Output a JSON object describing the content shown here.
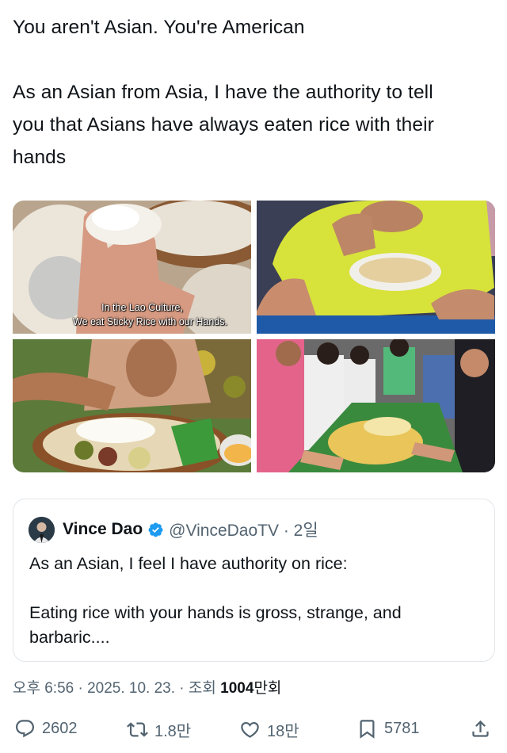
{
  "tweet": {
    "line1": "You aren't Asian. You're American",
    "line2": "As an Asian from Asia, I have the authority to tell",
    "line3": "you that Asians have always eaten rice with their",
    "line4": "hands"
  },
  "media": {
    "caption_line1": "In the Lao Culture,",
    "caption_line2": "We eat Sticky Rice with our Hands."
  },
  "quote": {
    "name": "Vince Dao",
    "handle": "@VinceDaoTV · 2일",
    "text_line1": "As an Asian, I feel I have authority on rice:",
    "text_line2": "Eating rice with your hands is gross, strange, and",
    "text_line3": "barbaric...."
  },
  "meta": {
    "time_date": "오후 6:56 · 2025. 10. 23. · 조회 ",
    "views_number": "1004",
    "views_unit": "만회"
  },
  "actions": {
    "replies": "2602",
    "reposts": "1.8만",
    "likes": "18만",
    "bookmarks": "5781"
  },
  "colors": {
    "text": "#0f1419",
    "secondary": "#536471",
    "border": "#e2e6ea",
    "verified": "#1d9bf0"
  },
  "icons": [
    "reply-icon",
    "retweet-icon",
    "heart-icon",
    "bookmark-icon",
    "share-icon",
    "verified-badge-icon"
  ]
}
